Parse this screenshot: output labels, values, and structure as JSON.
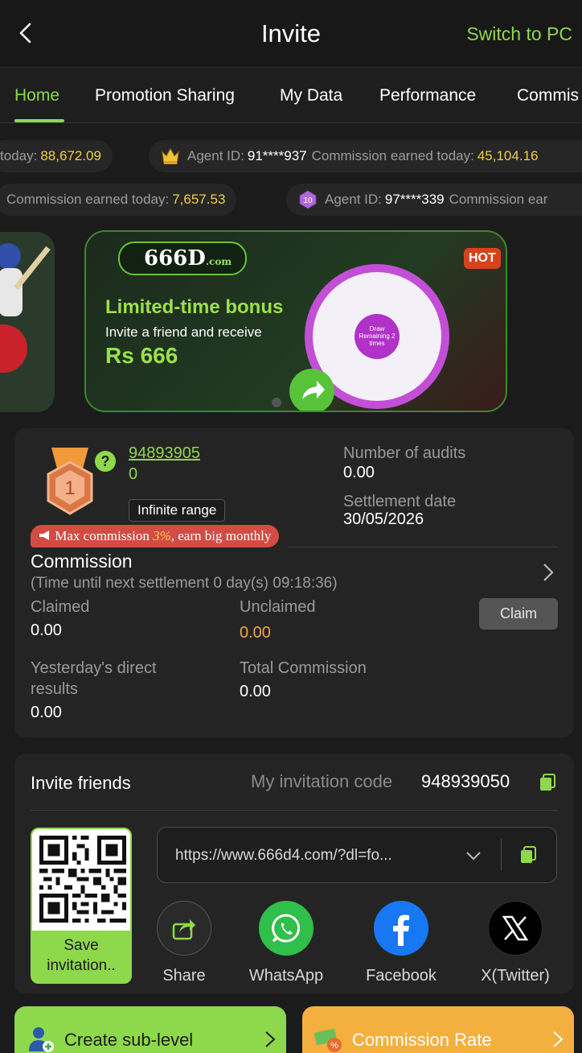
{
  "header": {
    "title": "Invite",
    "switch_label": "Switch to PC"
  },
  "tabs": [
    {
      "label": "Home"
    },
    {
      "label": "Promotion Sharing"
    },
    {
      "label": "My Data"
    },
    {
      "label": "Performance"
    },
    {
      "label": "Commis"
    }
  ],
  "ticker": {
    "row1": [
      {
        "label": "today:",
        "value": "88,672.09"
      },
      {
        "prefix": "Agent ID:",
        "agent_id": "91****937",
        "label": "Commission earned today:",
        "value": "45,104.16"
      }
    ],
    "row2": [
      {
        "label": "Commission earned today:",
        "value": "7,657.53"
      },
      {
        "prefix": "Agent ID:",
        "agent_id": "97****339",
        "label": "Commission ear"
      }
    ]
  },
  "banner": {
    "logo": "666D",
    "logo_suffix": ".com",
    "headline": "Limited-time bonus",
    "subline": "Invite a friend and receive",
    "amount": "Rs 666",
    "hot": "HOT",
    "wheel_center": "Draw",
    "wheel_remaining": "Remaining 2 times"
  },
  "agent": {
    "level": "1",
    "id": "94893905",
    "sub": "0",
    "range": "Infinite range",
    "audits_label": "Number of audits",
    "audits_value": "0.00",
    "settlement_label": "Settlement date",
    "settlement_value": "30/05/2026",
    "promo_prefix": "Max commission ",
    "promo_highlight": "3%",
    "promo_suffix": ", earn big monthly"
  },
  "commission": {
    "title": "Commission",
    "timer": "(Time until next settlement  0 day(s) 09:18:36)",
    "claimed_label": "Claimed",
    "claimed_value": "0.00",
    "unclaimed_label": "Unclaimed",
    "unclaimed_value": "0.00",
    "claim_button": "Claim",
    "yesterday_label_1": "Yesterday's direct",
    "yesterday_label_2": "results",
    "yesterday_value": "0.00",
    "total_label": "Total Commission",
    "total_value": "0.00"
  },
  "invite": {
    "title": "Invite friends",
    "code_label": "My invitation code",
    "code_value": "948939050",
    "save_label_1": "Save",
    "save_label_2": "invitation..",
    "link": "https://www.666d4.com/?dl=fo..."
  },
  "share": [
    {
      "label": "Share",
      "icon": "share-icon"
    },
    {
      "label": "WhatsApp",
      "icon": "whatsapp-icon"
    },
    {
      "label": "Facebook",
      "icon": "facebook-icon"
    },
    {
      "label": "X(Twitter)",
      "icon": "x-twitter-icon"
    }
  ],
  "bottom": {
    "create_label": "Create sub-level",
    "rate_label": "Commission Rate"
  },
  "colors": {
    "accent": "#8ed84c",
    "gold": "#f1cf44",
    "orange": "#f4b03f",
    "unclaimed": "#f0a64a"
  }
}
